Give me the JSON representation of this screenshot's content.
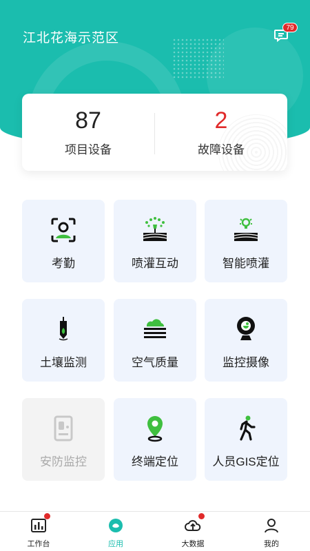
{
  "header": {
    "title": "江北花海示范区",
    "message_badge": "79"
  },
  "stats": [
    {
      "value": "87",
      "label": "项目设备",
      "color": "#222222"
    },
    {
      "value": "2",
      "label": "故障设备",
      "color": "#e02a2a"
    }
  ],
  "tiles": [
    {
      "label": "考勤",
      "icon": "face-scan-icon"
    },
    {
      "label": "喷灌互动",
      "icon": "sprinkler-icon"
    },
    {
      "label": "智能喷灌",
      "icon": "smart-irrigation-icon"
    },
    {
      "label": "土壤监测",
      "icon": "soil-sensor-icon"
    },
    {
      "label": "空气质量",
      "icon": "air-quality-icon"
    },
    {
      "label": "监控摄像",
      "icon": "webcam-icon"
    },
    {
      "label": "安防监控",
      "icon": "security-panel-icon",
      "disabled": true
    },
    {
      "label": "终端定位",
      "icon": "location-pin-icon"
    },
    {
      "label": "人员GIS定位",
      "icon": "walking-person-icon"
    }
  ],
  "tabbar": [
    {
      "label": "工作台",
      "icon": "chart-icon"
    },
    {
      "label": "应用",
      "icon": "apps-icon"
    },
    {
      "label": "大数据",
      "icon": "cloud-upload-icon"
    },
    {
      "label": "我的",
      "icon": "user-icon"
    }
  ],
  "colors": {
    "primary": "#1bbdae",
    "accent_green": "#3fbf3f",
    "alert": "#e02a2a",
    "tile_bg": "#eff4fd"
  }
}
